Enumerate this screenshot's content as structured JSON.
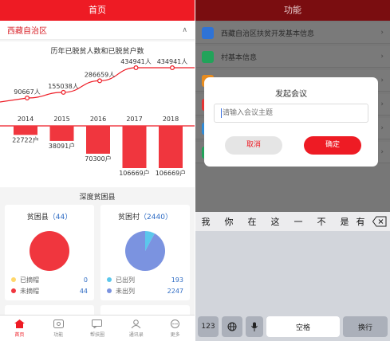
{
  "left": {
    "header_title": "首页",
    "region": {
      "name": "西藏自治区",
      "chevron": "chevron-up-icon"
    },
    "chart_title": "历年已脱贫人数和已脱贫户数",
    "section_title": "深度贫困县",
    "county_card": {
      "title": "贫困县",
      "count": "（44）",
      "legend": [
        {
          "label": "已摘帽",
          "value": "0",
          "color": "#ffd76b"
        },
        {
          "label": "未摘帽",
          "value": "44",
          "color": "#f0363e"
        }
      ]
    },
    "village_card": {
      "title": "贫困村",
      "count": "（2440）",
      "legend": [
        {
          "label": "已出列",
          "value": "193",
          "color": "#5bc7ec"
        },
        {
          "label": "未出列",
          "value": "2247",
          "color": "#7b93e0"
        }
      ]
    },
    "tabs": [
      {
        "label": "首页",
        "icon": "home-icon"
      },
      {
        "label": "功能",
        "icon": "function-icon"
      },
      {
        "label": "帮扶圈",
        "icon": "chat-icon"
      },
      {
        "label": "通讯录",
        "icon": "contacts-icon"
      },
      {
        "label": "更多",
        "icon": "more-icon"
      }
    ]
  },
  "right": {
    "header_title": "功能",
    "menu": [
      {
        "label": "西藏自治区扶贫开发基本信息",
        "icon": "info-icon",
        "color": "#2f73d6"
      },
      {
        "label": "村基本信息",
        "icon": "village-icon",
        "color": "#22a35a"
      },
      {
        "label": "",
        "icon": "item-icon",
        "color": "#e88c1f"
      },
      {
        "label": "",
        "icon": "item-icon",
        "color": "#e53434"
      },
      {
        "label": "",
        "icon": "item-icon",
        "color": "#2f8ad6"
      },
      {
        "label": "",
        "icon": "item-icon",
        "color": "#22a35a"
      }
    ],
    "dialog": {
      "title": "发起会议",
      "placeholder": "请输入会议主题",
      "cancel": "取消",
      "confirm": "确定"
    },
    "keyboard": {
      "candidates": [
        "我",
        "你",
        "在",
        "这",
        "一",
        "不",
        "是",
        "有"
      ],
      "keys": {
        "numbers": "123",
        "space": "空格",
        "enter": "换行"
      }
    }
  },
  "chart_data": {
    "type": "bar",
    "categories": [
      "2014",
      "2015",
      "2016",
      "2017",
      "2018"
    ],
    "series": [
      {
        "values": [
          90667,
          155038,
          286659,
          434941,
          434941
        ],
        "labels": [
          "90667人",
          "155038人",
          "286659人",
          "434941人",
          "434941人"
        ],
        "color": "#ee1b24",
        "kind": "line"
      },
      {
        "values": [
          22722,
          38091,
          70300,
          106669,
          106669
        ],
        "labels": [
          "22722户",
          "38091户",
          "70300户",
          "106669户",
          "106669户"
        ],
        "color": "#f0363e",
        "kind": "bar"
      }
    ],
    "title": "历年已脱贫人数和已脱贫户数"
  },
  "pies": [
    {
      "values": [
        0,
        44
      ],
      "colors": [
        "#ffd76b",
        "#f0363e"
      ]
    },
    {
      "values": [
        193,
        2247
      ],
      "colors": [
        "#5bc7ec",
        "#7b93e0"
      ]
    }
  ]
}
